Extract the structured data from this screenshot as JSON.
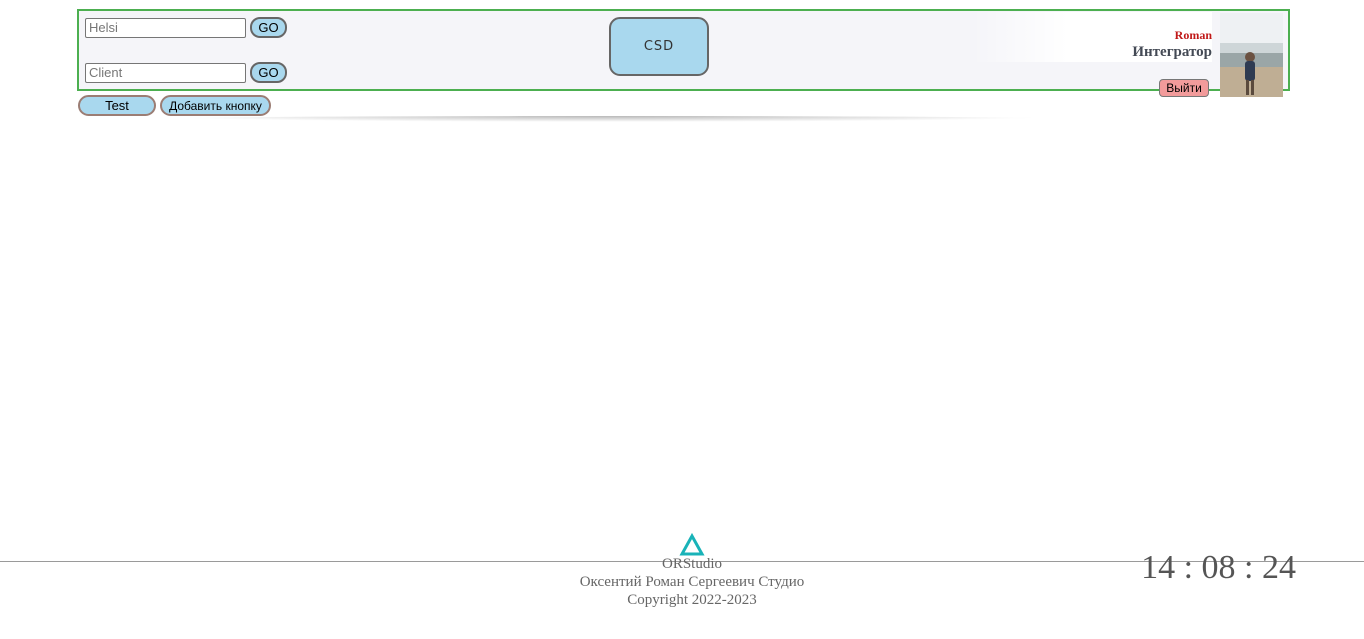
{
  "header": {
    "search_fields": [
      {
        "placeholder": "Helsi",
        "go_label": "GO"
      },
      {
        "placeholder": "Client",
        "go_label": "GO"
      }
    ],
    "center_button_label": "CSD",
    "user": {
      "name": "Roman",
      "role": "Интегратор",
      "logout_label": "Выйти"
    }
  },
  "toolbar": {
    "test_label": "Test",
    "add_button_label": "Добавить кнопку"
  },
  "footer": {
    "brand": "ORStudio",
    "owner": "Оксентий Роман Сергеевич Студио",
    "copyright": "Copyright 2022-2023",
    "clock": "14 : 08 : 24"
  },
  "colors": {
    "header_border": "#4caf50",
    "button_blue": "#a9d8ee",
    "logout_red": "#f29b9b",
    "user_name": "#c01818",
    "logo_teal": "#19b3b8"
  }
}
